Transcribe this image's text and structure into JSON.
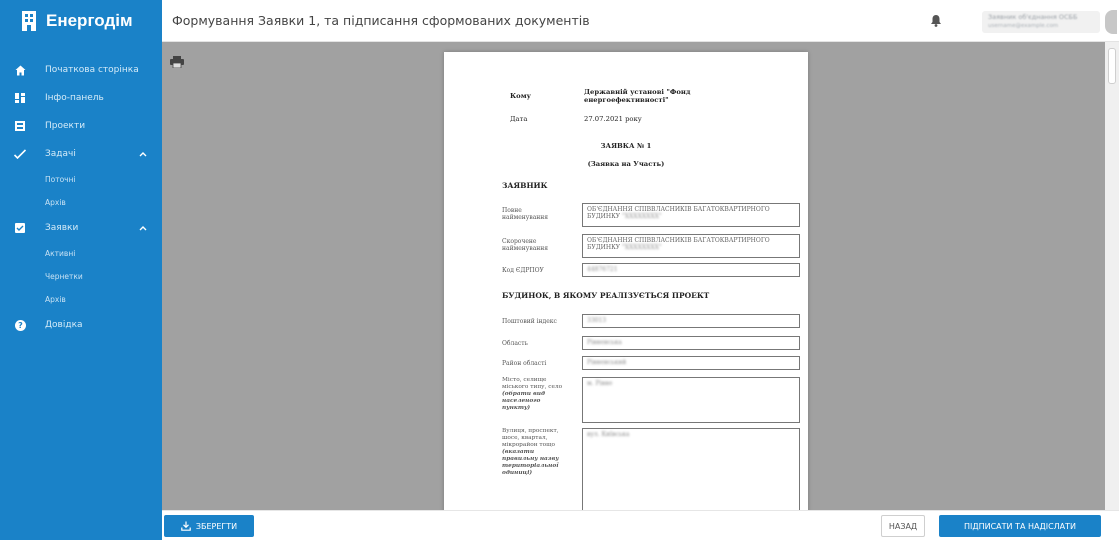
{
  "app": {
    "name": "Енергодім",
    "accent": "#1a82c8"
  },
  "header": {
    "title": "Формування Заявки 1, та підписання сформованих документів",
    "user_name": "Заявник об'єднання ОСББ",
    "user_email": "username@example.com"
  },
  "sidebar": {
    "items": [
      {
        "label": "Початкова сторінка",
        "icon": "home-icon"
      },
      {
        "label": "Інфо-панель",
        "icon": "dashboard-icon"
      },
      {
        "label": "Проекти",
        "icon": "projects-icon"
      },
      {
        "label": "Задачі",
        "icon": "tasks-icon",
        "children": [
          "Поточні",
          "Архів"
        ]
      },
      {
        "label": "Заявки",
        "icon": "checkbox-icon",
        "children": [
          "Активні",
          "Чернетки",
          "Архів"
        ]
      },
      {
        "label": "Довідка",
        "icon": "help-icon"
      }
    ]
  },
  "document": {
    "to_label": "Кому",
    "to_value": "Державній установі \"Фонд енергоефективності\"",
    "date_label": "Дата",
    "date_value": "27.07.2021 року",
    "heading": "ЗАЯВКА № 1",
    "subheading": "(Заявка на Участь)",
    "section1": "ЗАЯВНИК",
    "full_name_label": "Повне найменування",
    "full_name_value": "ОБ'ЄДНАННЯ СПІВВЛАСНИКІВ БАГАТОКВАРТИРНОГО БУДИНКУ",
    "full_name_hidden": "\"ХХХХХХХХ\"",
    "short_name_label": "Скорочене найменування",
    "short_name_value": "ОБ'ЄДНАННЯ СПІВВЛАСНИКІВ БАГАТОКВАРТИРНОГО БУДИНКУ",
    "short_name_hidden": "\"ХХХХХХХХ\"",
    "edrpou_label": "Код ЄДРПОУ",
    "edrpou_value": "44876721",
    "section2": "БУДИНОК, В ЯКОМУ РЕАЛІЗУЄТЬСЯ ПРОЕКТ",
    "postal_label": "Поштовий індекс",
    "postal_value": "33013",
    "region_label": "Область",
    "region_value": "Рівненська",
    "district_label": "Район області",
    "district_value": "Рівненський",
    "city_label_plain": "Місто, селище міського типу, село",
    "city_label_emph": "(обрати вид населеного пункту)",
    "city_value": "м. Рівне",
    "street_label_plain": "Вулиця, проспект, шосе, квартал, мікрорайон тощо",
    "street_label_emph": "(вказати правильну назву територіальної одиниці)",
    "street_value": "вул. Київська"
  },
  "footer": {
    "save_label": "ЗБЕРЕГТИ",
    "back_label": "НАЗАД",
    "sign_label": "ПІДПИСАТИ ТА НАДІСЛАТИ"
  }
}
